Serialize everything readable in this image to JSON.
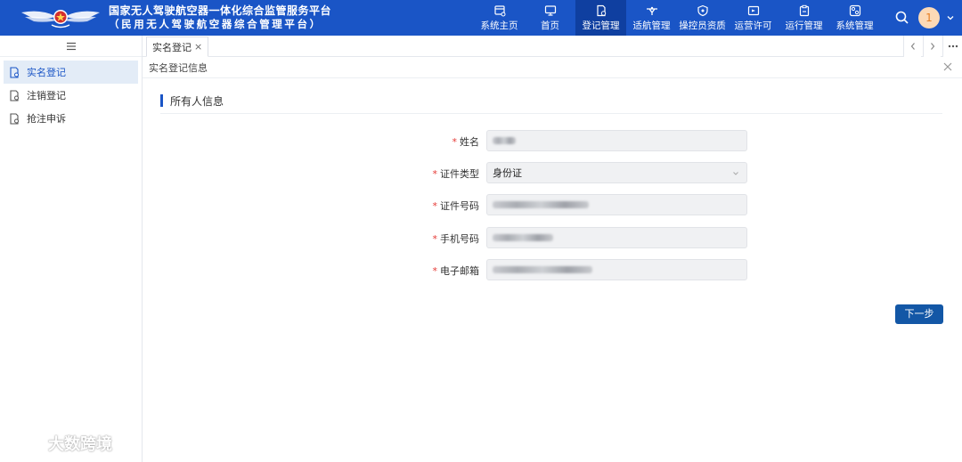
{
  "header": {
    "title_line1": "国家无人驾驶航空器一体化综合监管服务平台",
    "title_line2": "（民用无人驾驶航空器综合管理平台）",
    "nav": [
      {
        "label": "系统主页",
        "icon": "home-grid-icon",
        "active": false
      },
      {
        "label": "首页",
        "icon": "monitor-icon",
        "active": false
      },
      {
        "label": "登记管理",
        "icon": "register-doc-icon",
        "active": true
      },
      {
        "label": "适航管理",
        "icon": "plane-icon",
        "active": false
      },
      {
        "label": "操控员资质",
        "icon": "shield-icon",
        "active": false
      },
      {
        "label": "运营许可",
        "icon": "license-icon",
        "active": false
      },
      {
        "label": "运行管理",
        "icon": "clipboard-icon",
        "active": false
      },
      {
        "label": "系统管理",
        "icon": "settings-icon",
        "active": false
      }
    ],
    "avatar_badge": "1",
    "colors": {
      "topbar": "#1a55c6",
      "active_nav": "#0f3fa0"
    }
  },
  "sidebar": {
    "items": [
      {
        "label": "实名登记",
        "active": true
      },
      {
        "label": "注销登记",
        "active": false
      },
      {
        "label": "抢注申诉",
        "active": false
      }
    ]
  },
  "tabs": [
    {
      "label": "实名登记",
      "close": "×"
    }
  ],
  "panel": {
    "title": "实名登记信息",
    "section_title": "所有人信息",
    "fields": [
      {
        "label": "姓名",
        "required": "*",
        "value": ""
      },
      {
        "label": "证件类型",
        "required": "*",
        "value": "身份证"
      },
      {
        "label": "证件号码",
        "required": "*",
        "value": ""
      },
      {
        "label": "手机号码",
        "required": "*",
        "value": ""
      },
      {
        "label": "电子邮箱",
        "required": "*",
        "value": ""
      }
    ],
    "next_button": "下一步"
  },
  "watermark": {
    "text": "大数跨境"
  }
}
